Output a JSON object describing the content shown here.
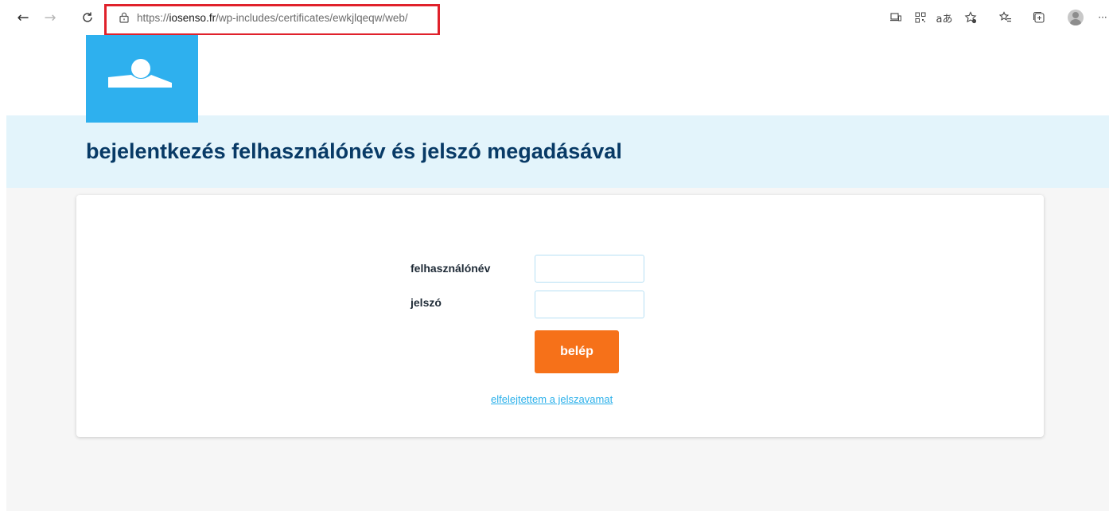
{
  "browser": {
    "url_scheme": "https://",
    "url_host": "iosenso.fr",
    "url_path": "/wp-includes/certificates/ewkjlqeqw/web/",
    "icons": [
      "back-arrow-icon",
      "forward-arrow-icon",
      "refresh-icon",
      "lock-icon",
      "app-available-icon",
      "qr-code-icon",
      "read-aloud-icon",
      "add-favorite-icon",
      "favorites-icon",
      "collections-icon",
      "profile-avatar-icon",
      "more-icon"
    ]
  },
  "brand": {
    "logo_color": "#2eb0ee"
  },
  "page": {
    "title": "bejelentkezés felhasználónév és jelszó megadásával"
  },
  "form": {
    "username_label": "felhasználónév",
    "username_value": "",
    "password_label": "jelszó",
    "password_value": "",
    "submit_label": "belép",
    "forgot_link": "elfelejtettem a jelszavamat"
  },
  "colors": {
    "title": "#083a66",
    "banner_bg": "#e3f4fb",
    "button": "#f67119",
    "link": "#2bb0ea",
    "url_highlight": "#e0212b"
  }
}
